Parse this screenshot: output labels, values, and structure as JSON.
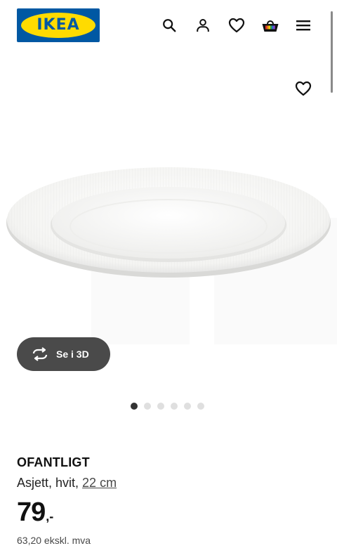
{
  "header": {
    "logo_text": "IKEA",
    "icons": [
      "search-icon",
      "account-icon",
      "favourites-icon",
      "cart-icon",
      "menu-icon"
    ]
  },
  "colors": {
    "brand_blue": "#0058a3",
    "brand_yellow": "#ffdb00",
    "button_dark": "#4a4a4a"
  },
  "gallery": {
    "view_3d_label": "Se i 3D",
    "image_count": 6,
    "active_index": 0
  },
  "product": {
    "name": "OFANTLIGT",
    "description": "Asjett, hvit,",
    "size": "22 cm",
    "price_integer": "79",
    "price_suffix": ",-",
    "price_ex_vat": "63,20 ekskl. mva"
  }
}
